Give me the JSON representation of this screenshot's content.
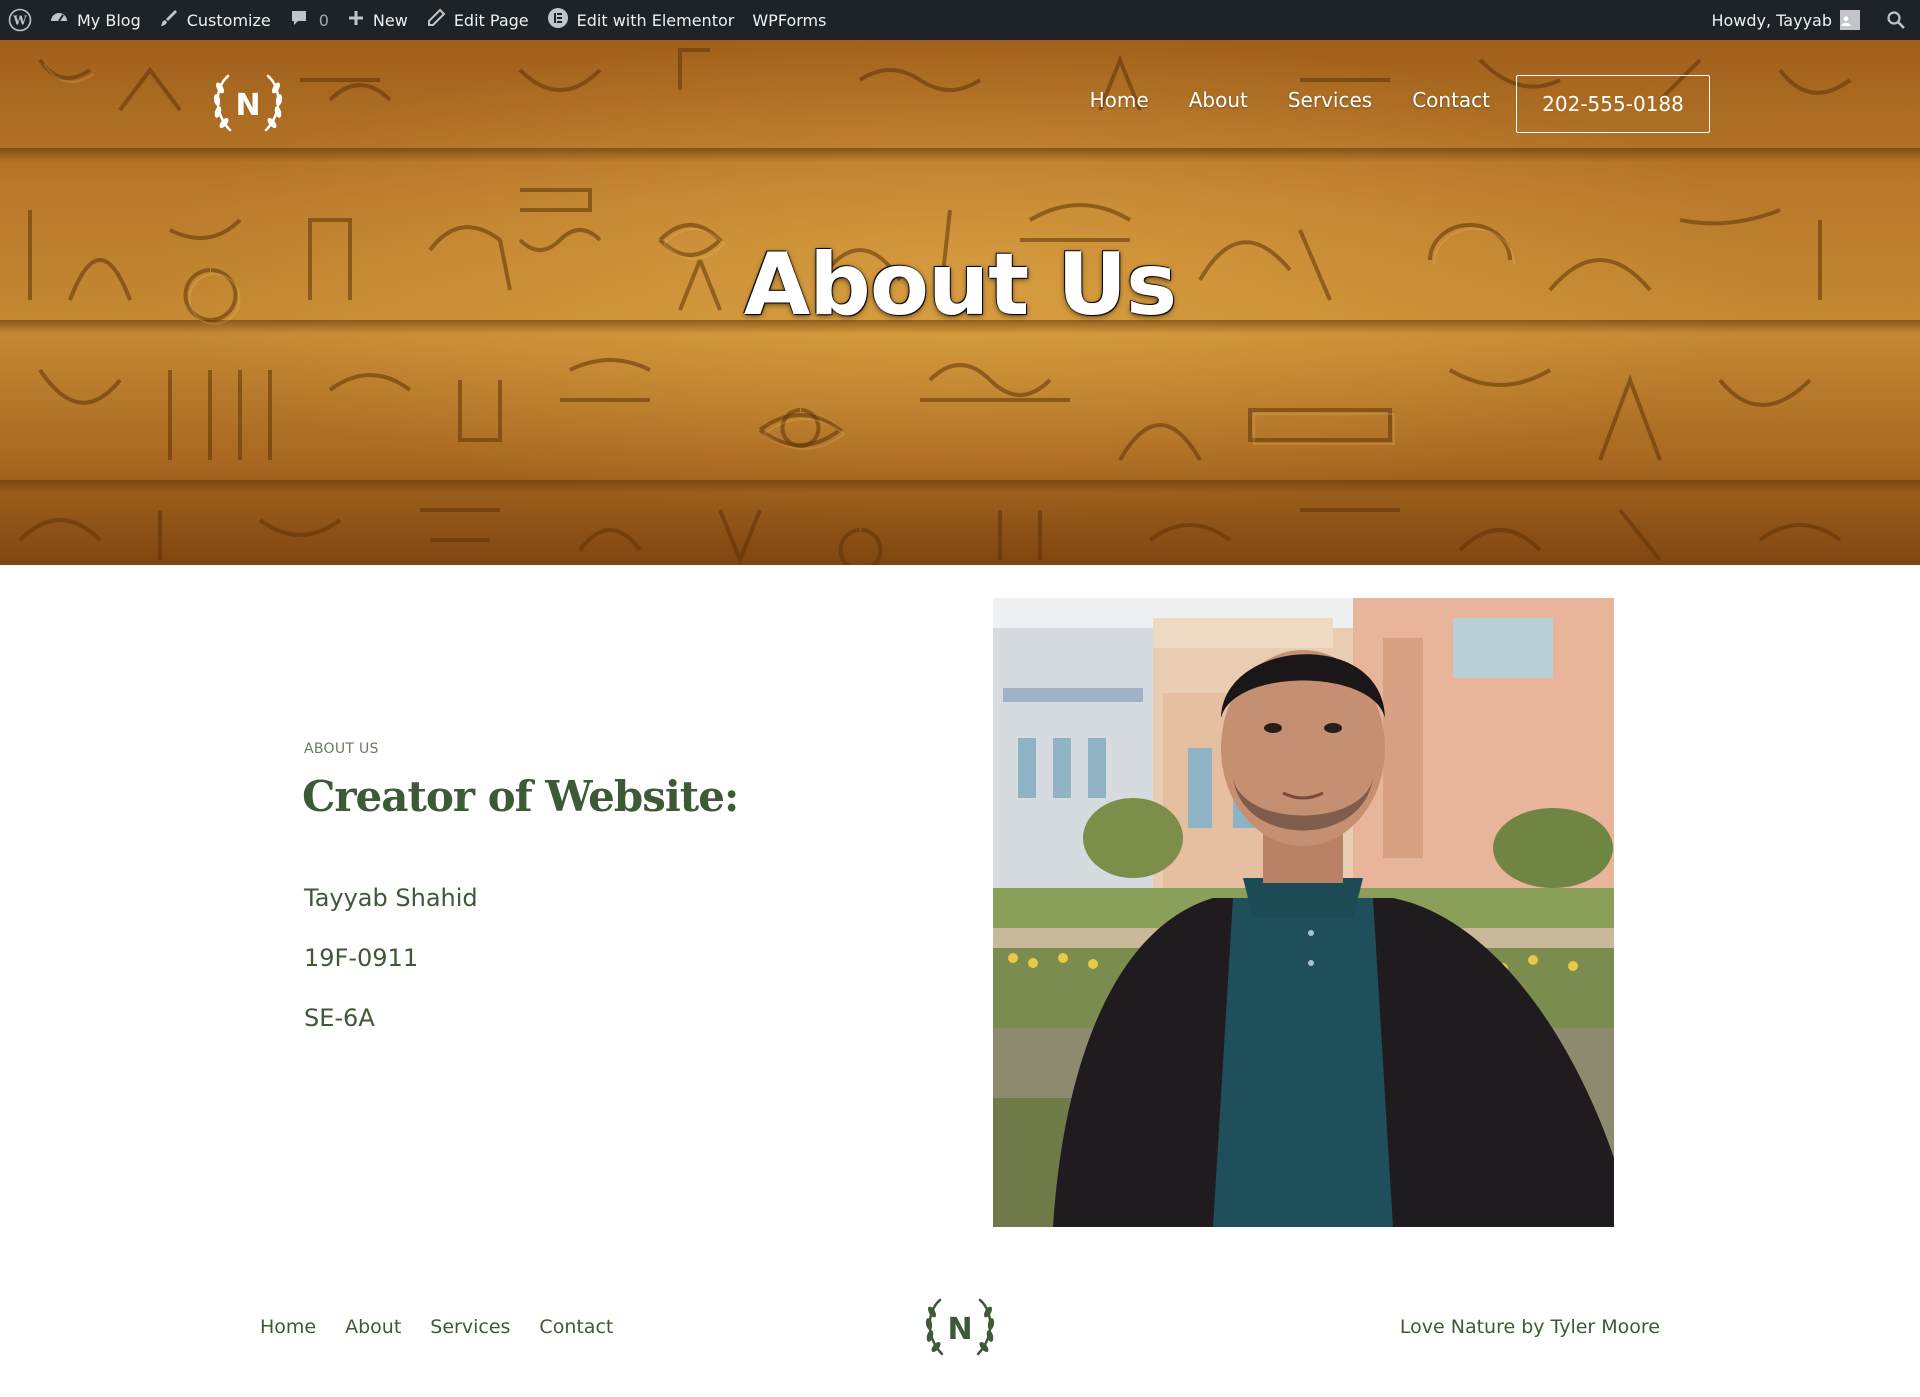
{
  "admin_bar": {
    "site_name": "My Blog",
    "customize": "Customize",
    "comments_count": "0",
    "new": "New",
    "edit_page": "Edit Page",
    "edit_with_elementor": "Edit with Elementor",
    "wpforms": "WPForms",
    "howdy": "Howdy, Tayyab"
  },
  "header": {
    "logo_letter": "N",
    "nav": [
      "Home",
      "About",
      "Services",
      "Contact"
    ],
    "phone": "202-555-0188"
  },
  "hero": {
    "title": "About Us"
  },
  "about": {
    "kicker": "ABOUT US",
    "headline": "Creator of Website:",
    "name": "Tayyab Shahid",
    "id": "19F-0911",
    "section": "SE-6A"
  },
  "footer": {
    "nav": [
      "Home",
      "About",
      "Services",
      "Contact"
    ],
    "logo_letter": "N",
    "credit": "Love Nature by Tyler Moore"
  },
  "colors": {
    "admin_bar_bg": "#1d2327",
    "accent_green": "#3d5a37",
    "hero_amber": "#b97a2b"
  }
}
